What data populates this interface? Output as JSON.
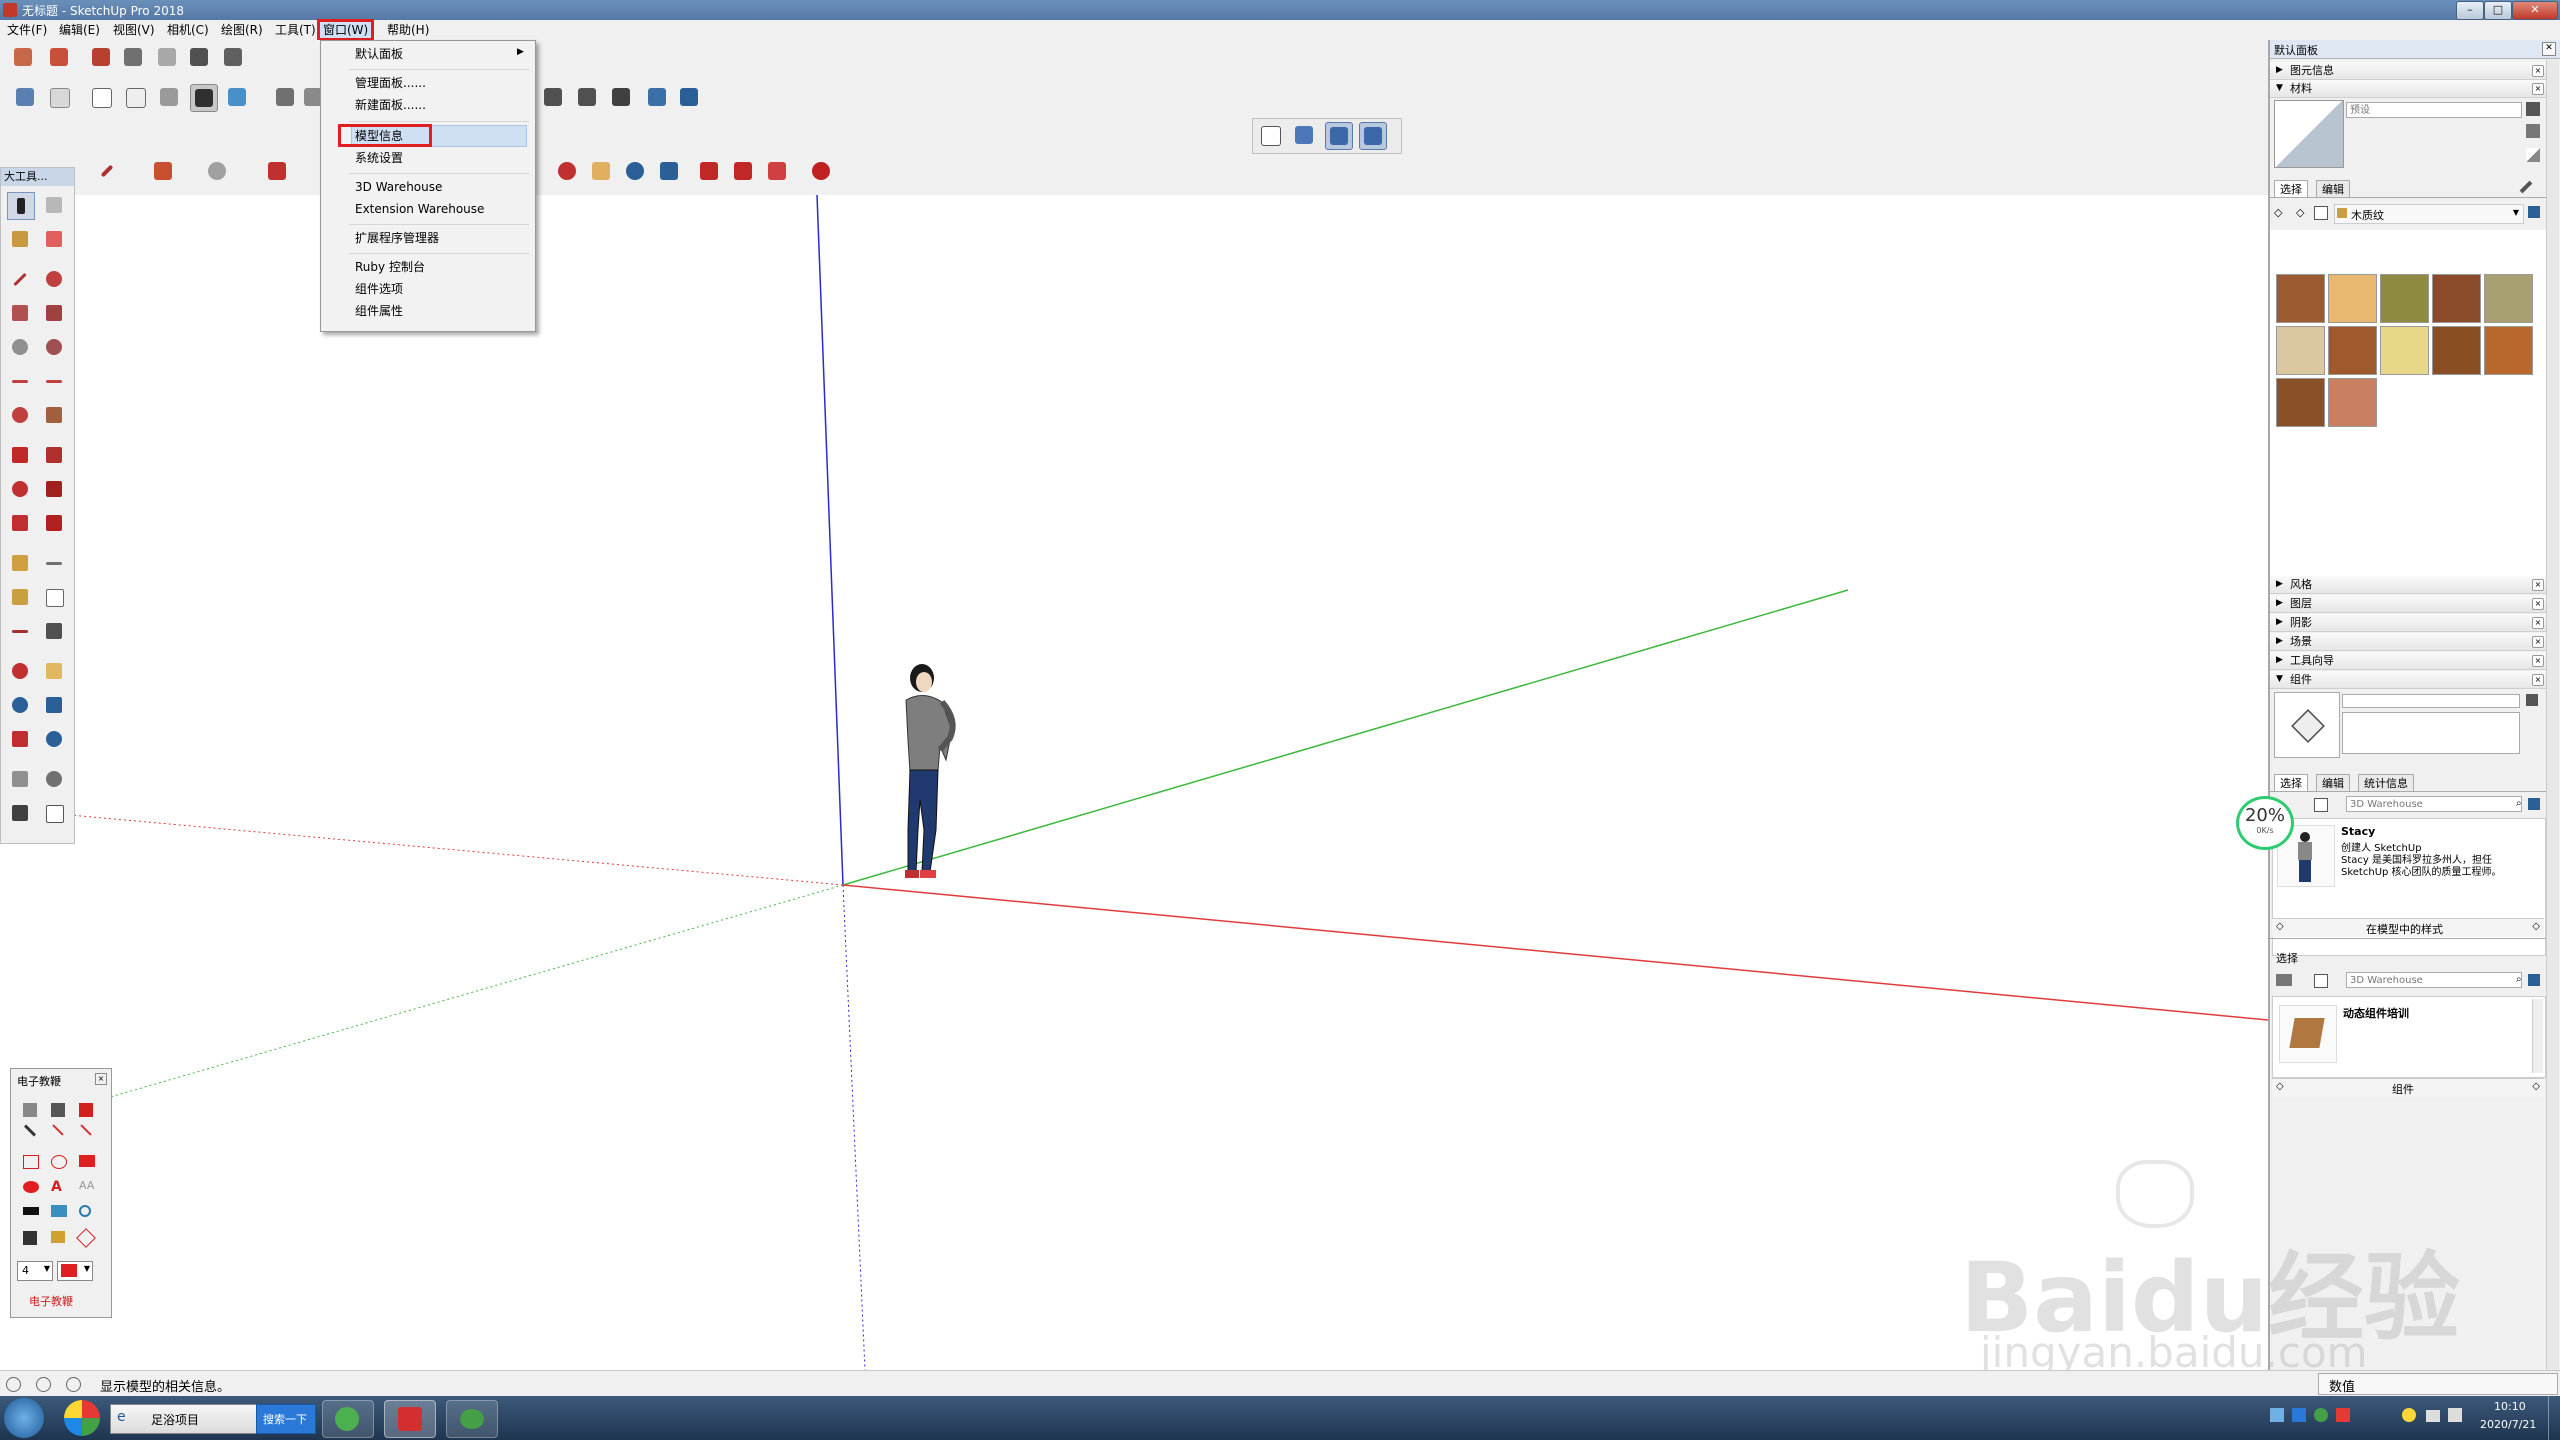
{
  "window": {
    "title": "无标题 - SketchUp Pro 2018"
  },
  "menubar": {
    "items": [
      "文件(F)",
      "编辑(E)",
      "视图(V)",
      "相机(C)",
      "绘图(R)",
      "工具(T)",
      "窗口(W)",
      "帮助(H)"
    ]
  },
  "window_menu": {
    "items": [
      {
        "label": "默认面板",
        "submenu": true
      },
      {
        "label": "管理面板......"
      },
      {
        "label": "新建面板......"
      },
      {
        "label": "模型信息",
        "highlighted": true
      },
      {
        "label": "系统设置"
      },
      {
        "label": "3D Warehouse"
      },
      {
        "label": "Extension Warehouse"
      },
      {
        "label": "扩展程序管理器"
      },
      {
        "label": "Ruby 控制台"
      },
      {
        "label": "组件选项"
      },
      {
        "label": "组件属性"
      }
    ]
  },
  "left_toolbar": {
    "title": "大工具..."
  },
  "edu_panel": {
    "title": "电子教鞭",
    "size_value": "4",
    "footer": "电子教鞭"
  },
  "status": {
    "text": "显示模型的相关信息。",
    "measure_label": "数值"
  },
  "right_panel": {
    "title": "默认面板",
    "sections_top": [
      "图元信息",
      "材料"
    ],
    "materials": {
      "name_placeholder": "预设",
      "tabs": [
        "选择",
        "编辑"
      ],
      "collection": "木质纹",
      "swatch_colors": [
        "#9c5a32",
        "#e8b870",
        "#8e8a40",
        "#8b4a2a",
        "#a8a070",
        "#dcc8a0",
        "#9e5a2c",
        "#e6d888",
        "#8a4e24",
        "#b8682c",
        "#8a5028",
        "#c88060"
      ]
    },
    "sections_mid": [
      "风格",
      "图层",
      "阴影",
      "场景",
      "工具向导",
      "组件"
    ],
    "components": {
      "tabs": [
        "选择",
        "编辑",
        "统计信息"
      ],
      "search_placeholder": "3D Warehouse",
      "item_title": "Stacy",
      "item_desc_line1": "创建人 SketchUp",
      "item_desc_line2": "Stacy 是美国科罗拉多州人，担任",
      "item_desc_line3": "SketchUp 核心团队的质量工程师。",
      "footer": "在模型中的样式"
    },
    "components2": {
      "header": "选择",
      "search_placeholder": "3D Warehouse",
      "item_title": "动态组件培训",
      "footer": "组件"
    }
  },
  "net_badge": {
    "percent": "20%",
    "speed": "0K/s"
  },
  "taskbar": {
    "ie_tab": "足浴项目",
    "search_btn": "搜索一下",
    "time": "10:10",
    "date": "2020/7/21"
  },
  "watermark": {
    "main": "Baidu经验",
    "sub": "jingyan.baidu.com"
  },
  "colors": {
    "axis_red": "#e23b3b",
    "axis_green": "#3fb83f",
    "axis_blue": "#2b2bd0",
    "highlight_red": "#e02020"
  }
}
